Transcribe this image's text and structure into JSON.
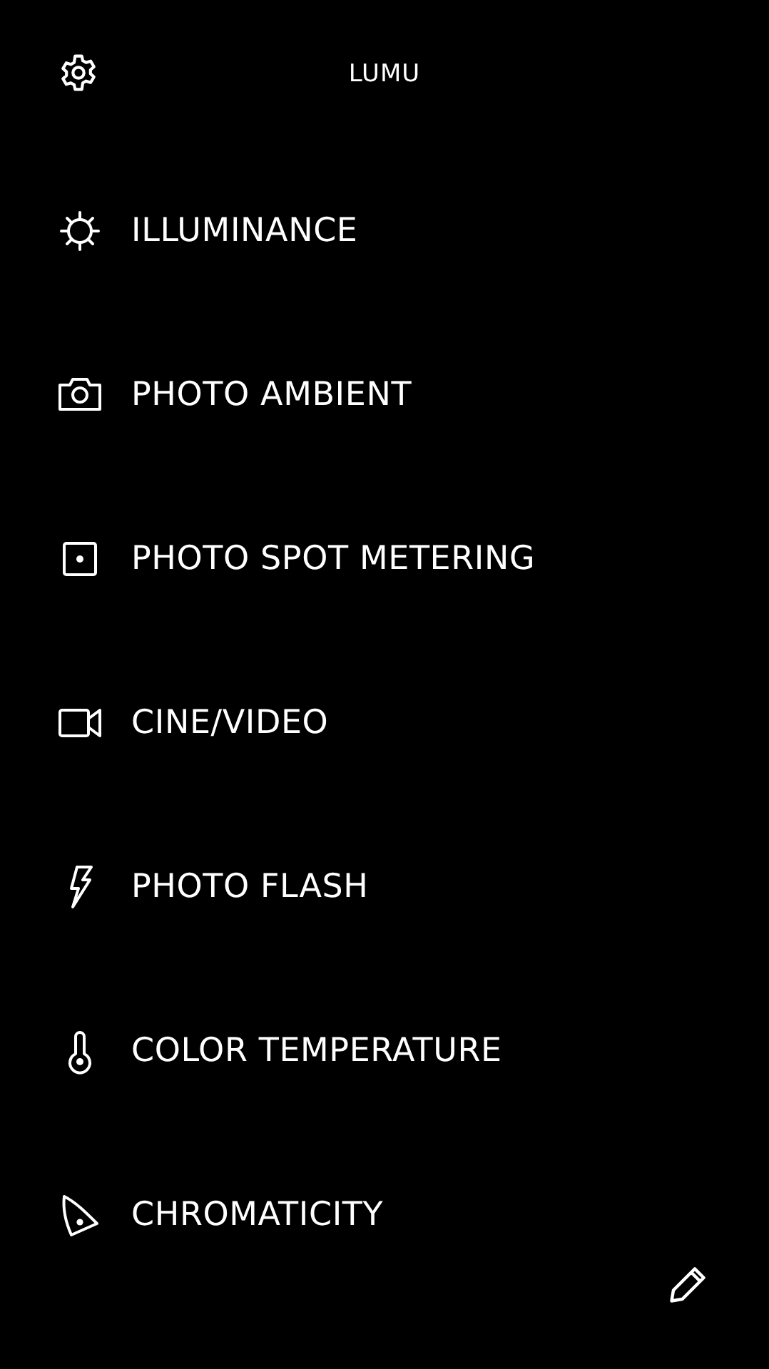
{
  "header": {
    "title": "LUMU"
  },
  "modes": [
    {
      "label": "ILLUMINANCE",
      "kind": "sun"
    },
    {
      "label": "PHOTO AMBIENT",
      "kind": "camera"
    },
    {
      "label": "PHOTO SPOT METERING",
      "kind": "spot"
    },
    {
      "label": "CINE/VIDEO",
      "kind": "video"
    },
    {
      "label": "PHOTO FLASH",
      "kind": "flash"
    },
    {
      "label": "COLOR TEMPERATURE",
      "kind": "thermometer"
    },
    {
      "label": "CHROMATICITY",
      "kind": "chromaticity"
    }
  ]
}
